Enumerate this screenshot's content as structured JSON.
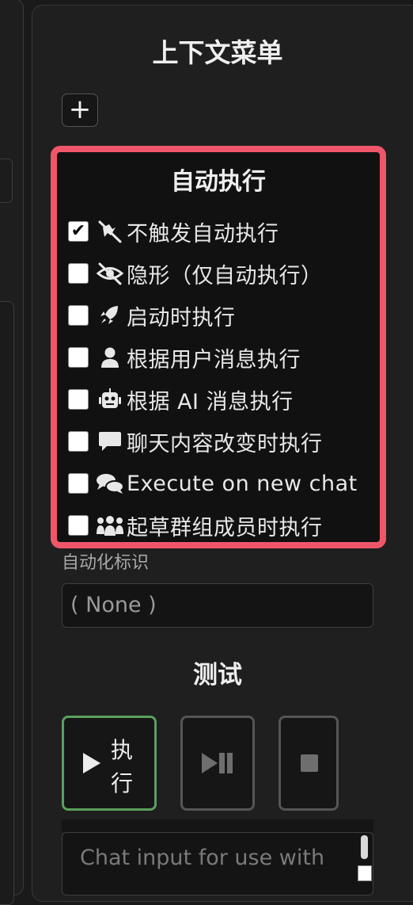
{
  "header": {
    "title": "上下文菜单",
    "add_label": "+"
  },
  "auto_execute": {
    "title": "自动执行",
    "options": [
      {
        "label": "不触发自动执行",
        "checked": true,
        "icon": "robot-slash-icon"
      },
      {
        "label": "隐形（仅自动执行）",
        "checked": false,
        "icon": "eye-slash-icon"
      },
      {
        "label": "启动时执行",
        "checked": false,
        "icon": "rocket-icon"
      },
      {
        "label": "根据用户消息执行",
        "checked": false,
        "icon": "user-icon"
      },
      {
        "label": "根据 AI 消息执行",
        "checked": false,
        "icon": "robot-icon"
      },
      {
        "label": "聊天内容改变时执行",
        "checked": false,
        "icon": "message-icon"
      },
      {
        "label": "Execute on new chat",
        "checked": false,
        "icon": "comments-icon"
      },
      {
        "label": "起草群组成员时执行",
        "checked": false,
        "icon": "people-group-icon"
      }
    ]
  },
  "automation_id": {
    "label": "自动化标识",
    "value": "( None )"
  },
  "test": {
    "title": "测试",
    "run_label_1": "执",
    "run_label_2": "行",
    "chat_placeholder": "Chat input for use with"
  },
  "colors": {
    "highlight": "#f0566a",
    "run_border": "#5aa05c"
  }
}
